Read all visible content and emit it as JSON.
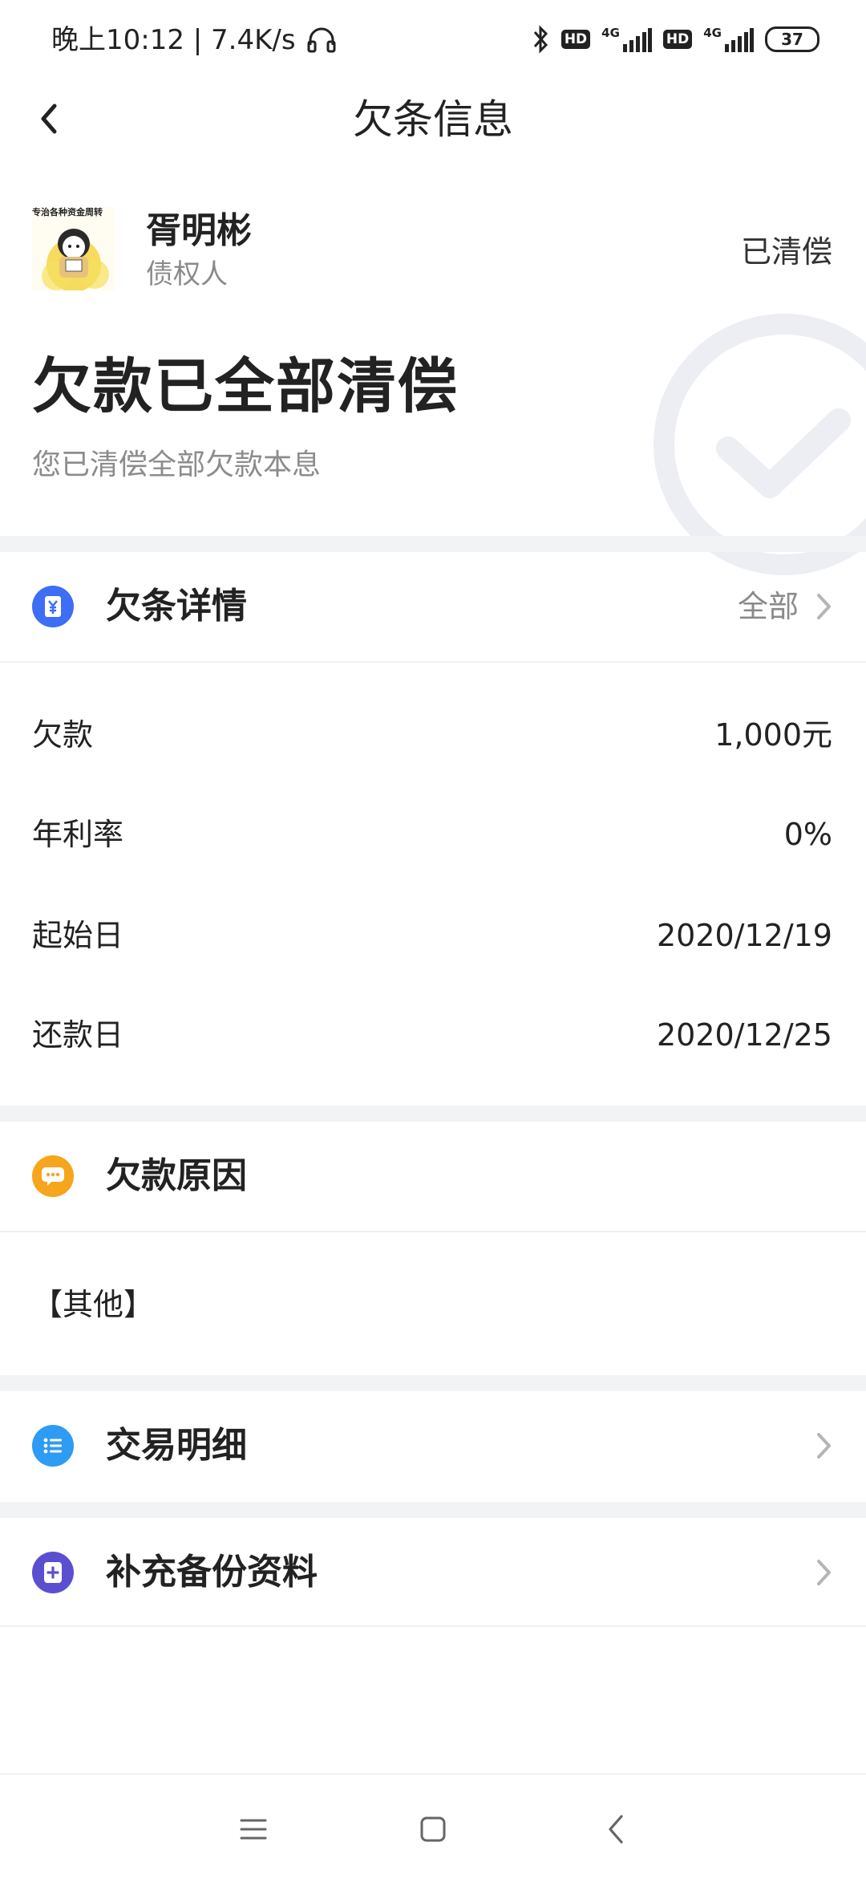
{
  "status_bar": {
    "time": "晚上10:12 | 7.4K/s",
    "hd1": "HD",
    "hd2": "HD",
    "net1": "4G",
    "net2": "4G",
    "battery": "37"
  },
  "nav": {
    "title": "欠条信息"
  },
  "header": {
    "creditor_name": "胥明彬",
    "creditor_role": "债权人",
    "status": "已清偿",
    "title": "欠款已全部清偿",
    "subtitle": "您已清偿全部欠款本息",
    "avatar_caption": "专治各种资金周转"
  },
  "details": {
    "title": "欠条详情",
    "all_label": "全部",
    "rows": [
      {
        "label": "欠款",
        "value": "1,000元"
      },
      {
        "label": "年利率",
        "value": "0%"
      },
      {
        "label": "起始日",
        "value": "2020/12/19"
      },
      {
        "label": "还款日",
        "value": "2020/12/25"
      }
    ]
  },
  "reason": {
    "title": "欠款原因",
    "text": "【其他】"
  },
  "transactions": {
    "title": "交易明细"
  },
  "backup": {
    "title": "补充备份资料"
  },
  "colors": {
    "details_icon": "#3d6ef5",
    "reason_icon": "#f7a51c",
    "transactions_icon": "#2e9bf5",
    "backup_icon": "#5a4fcf",
    "section_gap": "#f2f3f5"
  }
}
